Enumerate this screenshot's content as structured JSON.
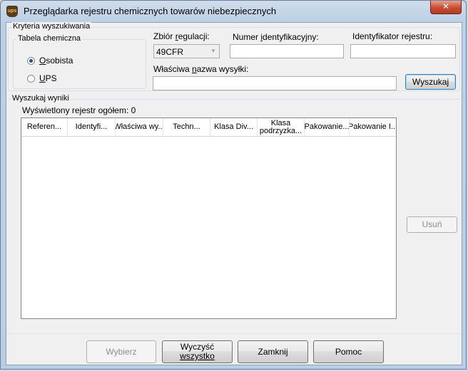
{
  "window": {
    "title": "Przeglądarka rejestru chemicznych towarów niebezpiecznych",
    "app_icon_text": "ups",
    "close_glyph": "✕"
  },
  "criteria": {
    "legend": "Kryteria wyszukiwania",
    "table_group": {
      "legend": "Tabela chemiczna",
      "options": [
        {
          "label": "Osobista",
          "mnemonic": "O",
          "rest": "sobista",
          "checked": true
        },
        {
          "label": "UPS",
          "mnemonic": "U",
          "rest": "PS",
          "checked": false
        }
      ]
    },
    "regulation": {
      "label_pre": "Zbiór ",
      "label_mn": "r",
      "label_post": "egulacji:",
      "value": "49CFR"
    },
    "id_number": {
      "label_pre": "Numer ",
      "label_mn": "i",
      "label_post": "dentyfikacyjny:",
      "value": ""
    },
    "registry_id": {
      "label": "Identyfikator rejestru:",
      "value": ""
    },
    "shipping_name": {
      "label_pre": "Właściwa ",
      "label_mn": "n",
      "label_post": "azwa wysyłki:",
      "value": ""
    },
    "search_button": "Wyszukaj"
  },
  "results": {
    "legend": "Wyszukaj wyniki",
    "count_text": "Wyświetlony rejestr ogółem: 0",
    "columns": [
      "Referen...",
      "Identyfi...",
      "Właściwa wy...",
      "Techn...",
      "Klasa Div...",
      "Klasa podrzyzka...",
      "Pakowanie...",
      "Pakowanie I..."
    ],
    "rows": [],
    "remove_button": "Usuń"
  },
  "footer": {
    "select_button": "Wybierz",
    "clear_button_line1": "Wyczyść",
    "clear_button_line2": "wszystko",
    "close_button": "Zamknij",
    "help_button": "Pomoc"
  }
}
